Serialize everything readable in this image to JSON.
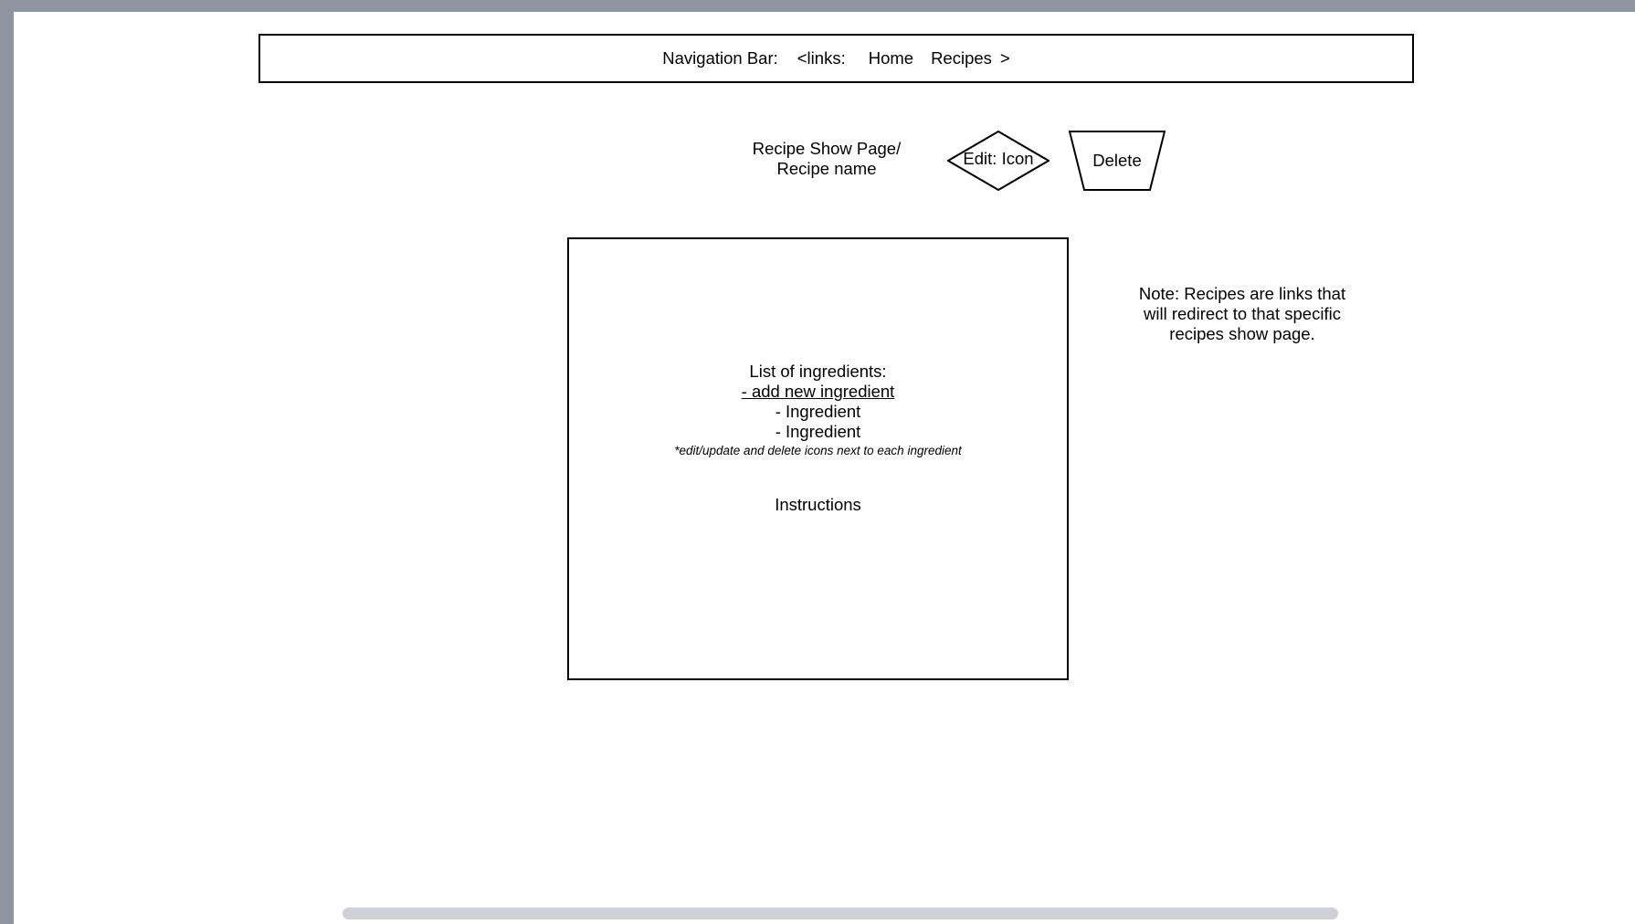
{
  "nav": {
    "label": "Navigation Bar:",
    "links_open": "<links:",
    "home": "Home",
    "recipes": "Recipes",
    "links_close": ">"
  },
  "page_title": {
    "line1": "Recipe Show Page/",
    "line2": "Recipe name"
  },
  "edit_shape_label": "Edit: Icon",
  "delete_shape_label": "Delete",
  "content": {
    "ingredients_heading": "List of ingredients:",
    "add_ingredient_link": "- add new ingredient",
    "ingredients": [
      "- Ingredient",
      "- Ingredient"
    ],
    "ingredient_note": "*edit/update and delete icons next to each ingredient",
    "instructions_label": "Instructions"
  },
  "note": {
    "line1": "Note: Recipes are links that",
    "line2": "will redirect to that specific",
    "line3": "recipes show page."
  }
}
